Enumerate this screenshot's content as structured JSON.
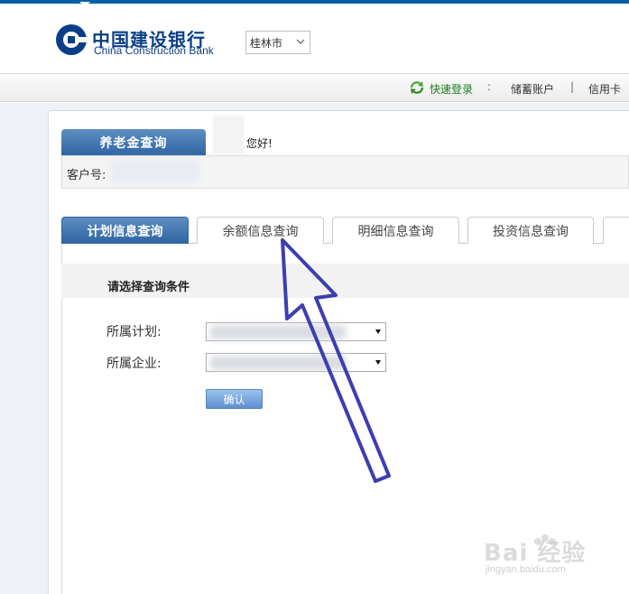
{
  "brand": {
    "name_cn": "中国建设银行",
    "name_en": "China Construction Bank",
    "accent": "#0a3f86"
  },
  "header": {
    "city": "桂林市"
  },
  "subnav": {
    "quick_login": "快速登录",
    "sep": ":",
    "savings": "储蓄账户",
    "sep2": "|",
    "credit": "信用卡"
  },
  "pension": {
    "tab_label": "养老金查询",
    "greeting": "您好!",
    "customer_label": "客户号:"
  },
  "tabs": [
    {
      "label": "计划信息查询",
      "active": true
    },
    {
      "label": "余额信息查询",
      "active": false
    },
    {
      "label": "明细信息查询",
      "active": false
    },
    {
      "label": "投资信息查询",
      "active": false
    }
  ],
  "form": {
    "title": "请选择查询条件",
    "plan_label": "所属计划:",
    "company_label": "所属企业:",
    "confirm_label": "确认"
  },
  "watermark": {
    "text": "Bai 经验",
    "sub": "jingyan.baidu.com"
  }
}
